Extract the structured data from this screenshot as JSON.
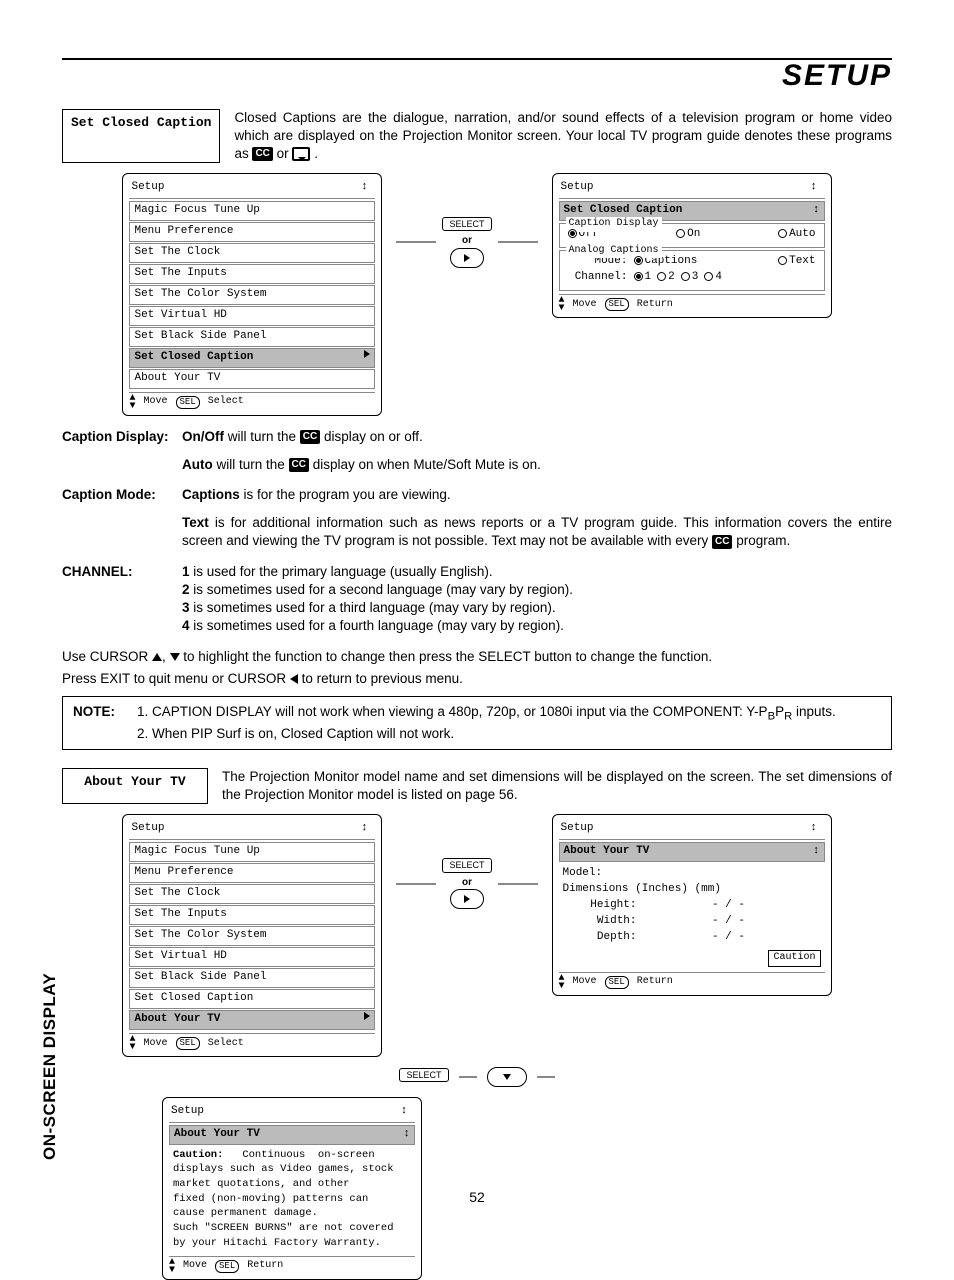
{
  "pageHeader": "SETUP",
  "sideTab": "ON-SCREEN DISPLAY",
  "pageNumber": "52",
  "ccIconText": "CC",
  "section1": {
    "title": "Set Closed Caption",
    "intro_part1": "Closed Captions are the dialogue, narration, and/or sound effects of a television program or home video which are displayed on the Projection Monitor screen.  Your local TV program guide denotes these programs as ",
    "intro_or": " or ",
    "intro_end": " ."
  },
  "osdMenuA": {
    "title": "Setup",
    "items": [
      "Magic Focus Tune Up",
      "Menu Preference",
      "Set The Clock",
      "Set The Inputs",
      "Set The Color System",
      "Set Virtual HD",
      "Set Black Side Panel",
      "Set Closed Caption",
      "About Your TV"
    ],
    "highlight": "Set Closed Caption",
    "footer_move": "Move",
    "footer_sel": "Select"
  },
  "midLabels": {
    "select": "SELECT",
    "or": "or"
  },
  "osdCC": {
    "title": "Setup",
    "breadcrumb": "Set Closed Caption",
    "grp1": "Caption Display",
    "opt_off": "Off",
    "opt_on": "On",
    "opt_auto": "Auto",
    "grp2": "Analog Captions",
    "mode_label": "Mode:",
    "mode_captions": "Captions",
    "mode_text": "Text",
    "channel_label": "Channel:",
    "ch1": "1",
    "ch2": "2",
    "ch3": "3",
    "ch4": "4",
    "footer_move": "Move",
    "footer_ret": "Return"
  },
  "explain": {
    "captionDisplay_label": "Caption Display:",
    "onoff_bold": "On/Off",
    "onoff_text": " will turn the ",
    "onoff_text2": " display on or off.",
    "auto_bold": "Auto",
    "auto_text": " will turn the ",
    "auto_text2": " display on when Mute/Soft Mute is on.",
    "mode_label": "Caption Mode:",
    "captions_bold": "Captions",
    "captions_text": " is for the program you are viewing.",
    "text_bold": "Text",
    "text_text": " is for additional information such as news reports or a TV program guide.  This information covers the entire screen and viewing the TV program is not possible.  Text may not be available with every ",
    "text_text2": " program.",
    "channel_label": "CHANNEL:",
    "ch1_b": "1",
    "ch1_t": " is used for the primary language (usually English).",
    "ch2_b": "2",
    "ch2_t": " is sometimes used for a second language (may vary by region).",
    "ch3_b": "3",
    "ch3_t": " is sometimes used for a third language (may vary by region).",
    "ch4_b": "4",
    "ch4_t": " is sometimes used for a fourth language (may vary by region).",
    "cursor_pre": "Use CURSOR ",
    "cursor_mid": ", ",
    "cursor_post": " to highlight the function to change then press the SELECT button to change the function.",
    "exit_pre": "Press EXIT to quit menu or CURSOR ",
    "exit_post": " to return to previous menu."
  },
  "note": {
    "label": "NOTE:",
    "l1_pre": "1.  CAPTION DISPLAY will not work when viewing a 480p, 720p, or 1080i input via the COMPONENT: Y-P",
    "l1_b": "B",
    "l1_p": "P",
    "l1_r": "R",
    "l1_post": " inputs.",
    "l2": "2.  When PIP Surf is on, Closed Caption will not work."
  },
  "section2": {
    "title": "About Your TV",
    "intro": "The Projection Monitor model name and set dimensions will be displayed on the screen.  The set dimensions of the Projection Monitor model is listed on page 56."
  },
  "osdMenuB": {
    "title": "Setup",
    "items": [
      "Magic Focus Tune Up",
      "Menu Preference",
      "Set The Clock",
      "Set The Inputs",
      "Set The Color System",
      "Set Virtual HD",
      "Set Black Side Panel",
      "Set Closed Caption",
      "About Your TV"
    ],
    "highlight": "About Your TV",
    "footer_move": "Move",
    "footer_sel": "Select"
  },
  "osdAbout": {
    "title": "Setup",
    "breadcrumb": "About Your TV",
    "model": "Model:",
    "dims": "Dimensions  (Inches) (mm)",
    "h": "Height:",
    "w": "Width:",
    "d": "Depth:",
    "val": "-  /  -",
    "caution": "Caution",
    "footer_move": "Move",
    "footer_ret": "Return"
  },
  "osdCaution": {
    "title": "Setup",
    "breadcrumb": "About Your TV",
    "line1": "Caution:   Continuous  on-screen",
    "line2": "displays such as Video games, stock",
    "line3": "market  quotations,  and  other",
    "line4": "fixed (non-moving) patterns can",
    "line5": "cause permanent damage.",
    "line6": "Such \"SCREEN BURNS\" are not covered",
    "line7": "by your Hitachi Factory Warranty.",
    "footer_move": "Move",
    "footer_ret": "Return"
  }
}
